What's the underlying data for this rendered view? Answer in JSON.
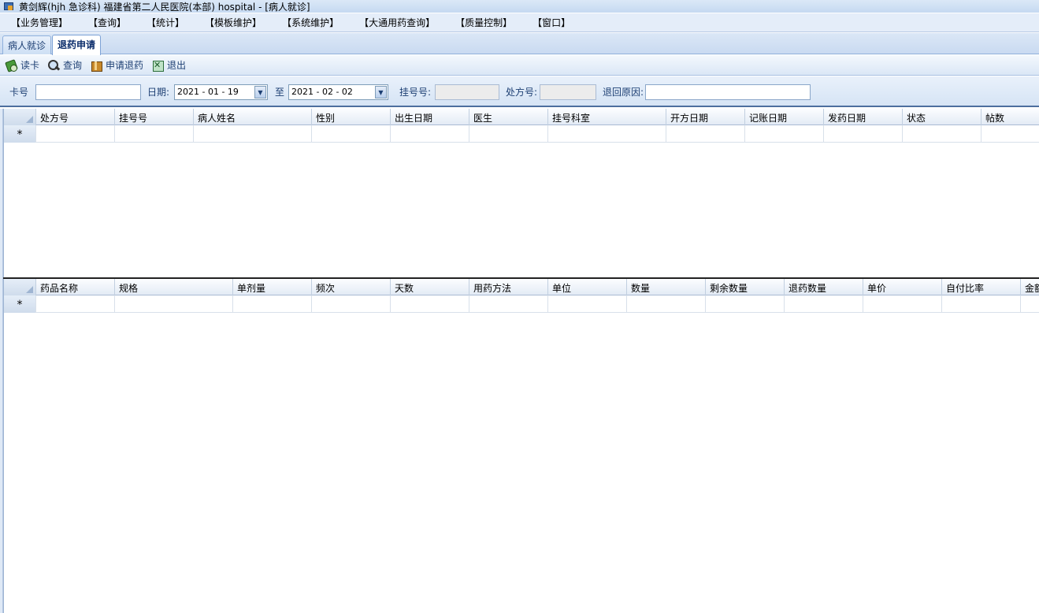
{
  "window": {
    "title": "黄剑辉(hjh 急诊科) 福建省第二人民医院(本部) hospital - [病人就诊]"
  },
  "menu": [
    "【业务管理】",
    "【查询】",
    "【统计】",
    "【模板维护】",
    "【系统维护】",
    "【大通用药查询】",
    "【质量控制】",
    "【窗口】"
  ],
  "tabs": [
    {
      "label": "病人就诊",
      "active": false
    },
    {
      "label": "退药申请",
      "active": true
    }
  ],
  "toolbar": {
    "read_card": "读卡",
    "query": "查询",
    "apply_refund": "申请退药",
    "exit": "退出"
  },
  "filter": {
    "card_label": "卡号",
    "card_value": "",
    "date_label": "日期:",
    "date_from": "2021 - 01 - 19",
    "to_label": "至",
    "date_to": "2021 - 02 - 02",
    "reg_no_label": "挂号号:",
    "reg_no_value": "",
    "rx_no_label": "处方号:",
    "rx_no_value": "",
    "reason_label": "退回原因:",
    "reason_value": ""
  },
  "grid1": {
    "columns": [
      "处方号",
      "挂号号",
      "病人姓名",
      "性别",
      "出生日期",
      "医生",
      "挂号科室",
      "开方日期",
      "记账日期",
      "发药日期",
      "状态",
      "帖数"
    ],
    "new_row_marker": "*"
  },
  "grid2": {
    "columns": [
      "药品名称",
      "规格",
      "单剂量",
      "频次",
      "天数",
      "用药方法",
      "单位",
      "数量",
      "剩余数量",
      "退药数量",
      "单价",
      "自付比率",
      "金额"
    ],
    "new_row_marker": "*"
  },
  "colors": {
    "menubar_bg": "#e4edf9",
    "tab_text": "#1d3f73",
    "grid_divider": "#222222"
  }
}
